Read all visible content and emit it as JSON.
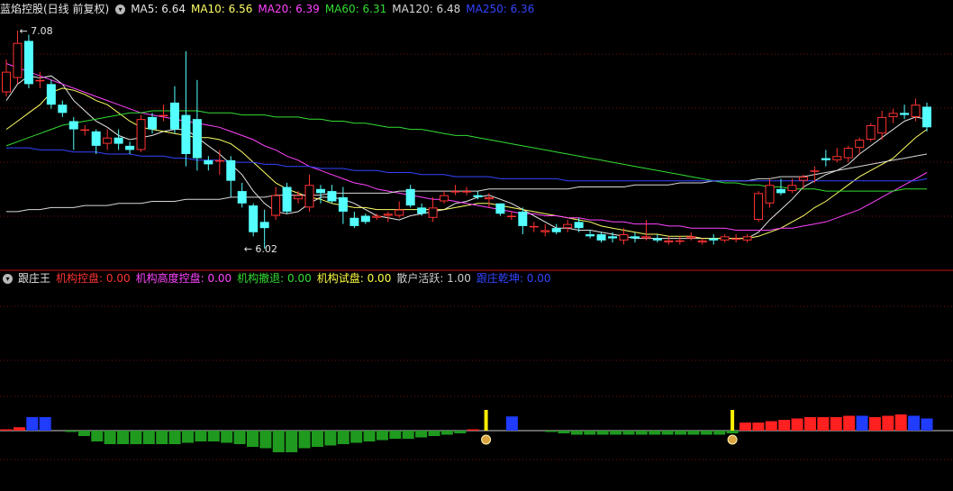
{
  "main_title": "蓝焰控股(日线 前复权)",
  "main_legend": [
    {
      "label": "MA5: 6.64",
      "color": "#e6e6e6"
    },
    {
      "label": "MA10: 6.56",
      "color": "#ffff66"
    },
    {
      "label": "MA20: 6.39",
      "color": "#ff44ff"
    },
    {
      "label": "MA60: 6.31",
      "color": "#33dd33"
    },
    {
      "label": "MA120: 6.48",
      "color": "#d8d8d8"
    },
    {
      "label": "MA250: 6.36",
      "color": "#3344ff"
    }
  ],
  "sub_title": "跟庄王",
  "sub_legend": [
    {
      "label": "机构控盘: 0.00",
      "color": "#ff3333"
    },
    {
      "label": "机构高度控盘: 0.00",
      "color": "#ff44ff"
    },
    {
      "label": "机构撤退: 0.00",
      "color": "#33dd33"
    },
    {
      "label": "机构试盘: 0.00",
      "color": "#ffff44"
    },
    {
      "label": "散户活跃: 1.00",
      "color": "#cccccc"
    },
    {
      "label": "跟庄乾坤: 0.00",
      "color": "#3344ff"
    }
  ],
  "chart_data": [
    {
      "type": "candlestick",
      "annotations": [
        {
          "text": "7.08",
          "bar": 1,
          "value": 7.08
        },
        {
          "text": "6.02",
          "bar": 21,
          "value": 6.02
        }
      ],
      "ylim": [
        5.95,
        7.15
      ],
      "candles": [
        [
          6.78,
          6.88,
          6.94,
          6.76
        ],
        [
          6.85,
          7.02,
          7.08,
          6.82
        ],
        [
          7.03,
          6.82,
          7.06,
          6.8
        ],
        [
          6.84,
          6.84,
          6.88,
          6.8
        ],
        [
          6.82,
          6.72,
          6.84,
          6.7
        ],
        [
          6.72,
          6.68,
          6.74,
          6.66
        ],
        [
          6.64,
          6.6,
          6.66,
          6.5
        ],
        [
          6.6,
          6.6,
          6.62,
          6.57
        ],
        [
          6.59,
          6.52,
          6.6,
          6.48
        ],
        [
          6.53,
          6.56,
          6.6,
          6.5
        ],
        [
          6.56,
          6.53,
          6.6,
          6.5
        ],
        [
          6.52,
          6.5,
          6.54,
          6.48
        ],
        [
          6.5,
          6.65,
          6.67,
          6.49
        ],
        [
          6.66,
          6.6,
          6.68,
          6.58
        ],
        [
          6.67,
          6.67,
          6.72,
          6.64
        ],
        [
          6.73,
          6.6,
          6.81,
          6.58
        ],
        [
          6.67,
          6.48,
          6.98,
          6.42
        ],
        [
          6.65,
          6.46,
          6.84,
          6.4
        ],
        [
          6.45,
          6.43,
          6.47,
          6.4
        ],
        [
          6.45,
          6.45,
          6.5,
          6.38
        ],
        [
          6.45,
          6.35,
          6.47,
          6.27
        ],
        [
          6.3,
          6.24,
          6.34,
          6.22
        ],
        [
          6.23,
          6.1,
          6.24,
          6.08
        ],
        [
          6.15,
          6.12,
          6.21,
          6.02
        ],
        [
          6.18,
          6.28,
          6.32,
          6.16
        ],
        [
          6.32,
          6.2,
          6.34,
          6.19
        ],
        [
          6.26,
          6.28,
          6.3,
          6.24
        ],
        [
          6.22,
          6.33,
          6.38,
          6.2
        ],
        [
          6.31,
          6.29,
          6.33,
          6.24
        ],
        [
          6.3,
          6.25,
          6.33,
          6.24
        ],
        [
          6.27,
          6.2,
          6.32,
          6.14
        ],
        [
          6.17,
          6.13,
          6.2,
          6.12
        ],
        [
          6.18,
          6.15,
          6.19,
          6.14
        ],
        [
          6.17,
          6.18,
          6.19,
          6.16
        ],
        [
          6.18,
          6.19,
          6.2,
          6.15
        ],
        [
          6.18,
          6.21,
          6.25,
          6.17
        ],
        [
          6.31,
          6.23,
          6.33,
          6.22
        ],
        [
          6.22,
          6.19,
          6.24,
          6.18
        ],
        [
          6.17,
          6.22,
          6.27,
          6.15
        ],
        [
          6.25,
          6.28,
          6.3,
          6.24
        ],
        [
          6.3,
          6.3,
          6.33,
          6.28
        ],
        [
          6.3,
          6.3,
          6.32,
          6.28
        ],
        [
          6.28,
          6.27,
          6.3,
          6.26
        ],
        [
          6.26,
          6.27,
          6.29,
          6.22
        ],
        [
          6.24,
          6.19,
          6.24,
          6.18
        ],
        [
          6.18,
          6.18,
          6.2,
          6.16
        ],
        [
          6.2,
          6.13,
          6.22,
          6.09
        ],
        [
          6.13,
          6.13,
          6.15,
          6.1
        ],
        [
          6.1,
          6.11,
          6.14,
          6.08
        ],
        [
          6.12,
          6.1,
          6.14,
          6.09
        ],
        [
          6.12,
          6.14,
          6.16,
          6.1
        ],
        [
          6.15,
          6.12,
          6.17,
          6.1
        ],
        [
          6.09,
          6.08,
          6.11,
          6.07
        ],
        [
          6.09,
          6.06,
          6.1,
          6.05
        ],
        [
          6.08,
          6.07,
          6.1,
          6.05
        ],
        [
          6.06,
          6.09,
          6.12,
          6.04
        ],
        [
          6.08,
          6.07,
          6.1,
          6.05
        ],
        [
          6.07,
          6.08,
          6.16,
          6.06
        ],
        [
          6.07,
          6.06,
          6.09,
          6.05
        ],
        [
          6.05,
          6.06,
          6.08,
          6.04
        ],
        [
          6.06,
          6.06,
          6.08,
          6.04
        ],
        [
          6.07,
          6.08,
          6.1,
          6.06
        ],
        [
          6.05,
          6.06,
          6.07,
          6.04
        ],
        [
          6.07,
          6.06,
          6.09,
          6.04
        ],
        [
          6.06,
          6.08,
          6.09,
          6.05
        ],
        [
          6.07,
          6.07,
          6.09,
          6.05
        ],
        [
          6.06,
          6.08,
          6.09,
          6.05
        ],
        [
          6.16,
          6.29,
          6.3,
          6.15
        ],
        [
          6.24,
          6.33,
          6.36,
          6.22
        ],
        [
          6.31,
          6.29,
          6.36,
          6.28
        ],
        [
          6.3,
          6.33,
          6.36,
          6.29
        ],
        [
          6.35,
          6.37,
          6.38,
          6.31
        ],
        [
          6.4,
          6.4,
          6.42,
          6.34
        ],
        [
          6.46,
          6.45,
          6.5,
          6.42
        ],
        [
          6.45,
          6.47,
          6.51,
          6.44
        ],
        [
          6.46,
          6.51,
          6.52,
          6.44
        ],
        [
          6.51,
          6.55,
          6.56,
          6.48
        ],
        [
          6.55,
          6.62,
          6.63,
          6.54
        ],
        [
          6.58,
          6.66,
          6.69,
          6.55
        ],
        [
          6.66,
          6.68,
          6.7,
          6.63
        ],
        [
          6.68,
          6.67,
          6.72,
          6.65
        ],
        [
          6.66,
          6.72,
          6.75,
          6.64
        ],
        [
          6.71,
          6.61,
          6.73,
          6.59
        ]
      ],
      "ma": [
        {
          "name": "MA5",
          "values": [
            6.74,
            6.82,
            6.86,
            6.85,
            6.86,
            6.82,
            6.74,
            6.69,
            6.64,
            6.61,
            6.57,
            6.55,
            6.56,
            6.57,
            6.59,
            6.6,
            6.6,
            6.56,
            6.52,
            6.48,
            6.43,
            6.38,
            6.3,
            6.24,
            6.2,
            6.19,
            6.2,
            6.24,
            6.27,
            6.27,
            6.26,
            6.24,
            6.21,
            6.18,
            6.17,
            6.16,
            6.18,
            6.19,
            6.2,
            6.21,
            6.24,
            6.25,
            6.27,
            6.28,
            6.26,
            6.24,
            6.21,
            6.18,
            6.15,
            6.12,
            6.12,
            6.11,
            6.11,
            6.1,
            6.09,
            6.08,
            6.07,
            6.07,
            6.07,
            6.07,
            6.07,
            6.07,
            6.07,
            6.07,
            6.07,
            6.07,
            6.07,
            6.1,
            6.16,
            6.21,
            6.26,
            6.32,
            6.35,
            6.38,
            6.4,
            6.43,
            6.48,
            6.52,
            6.56,
            6.6,
            6.64,
            6.66,
            6.65
          ]
        },
        {
          "name": "MA10",
          "values": [
            6.6,
            6.64,
            6.68,
            6.72,
            6.78,
            6.8,
            6.79,
            6.77,
            6.74,
            6.72,
            6.68,
            6.64,
            6.61,
            6.6,
            6.59,
            6.58,
            6.57,
            6.56,
            6.56,
            6.55,
            6.53,
            6.49,
            6.44,
            6.39,
            6.34,
            6.31,
            6.29,
            6.27,
            6.26,
            6.24,
            6.23,
            6.22,
            6.22,
            6.21,
            6.21,
            6.21,
            6.21,
            6.21,
            6.21,
            6.21,
            6.22,
            6.23,
            6.24,
            6.24,
            6.23,
            6.22,
            6.21,
            6.2,
            6.19,
            6.18,
            6.17,
            6.16,
            6.15,
            6.13,
            6.12,
            6.11,
            6.1,
            6.09,
            6.09,
            6.08,
            6.08,
            6.08,
            6.07,
            6.07,
            6.07,
            6.07,
            6.07,
            6.08,
            6.1,
            6.12,
            6.15,
            6.18,
            6.22,
            6.25,
            6.29,
            6.33,
            6.37,
            6.4,
            6.43,
            6.46,
            6.51,
            6.56,
            6.6
          ]
        },
        {
          "name": "MA20",
          "values": [
            6.92,
            6.9,
            6.88,
            6.86,
            6.84,
            6.82,
            6.8,
            6.78,
            6.76,
            6.74,
            6.72,
            6.7,
            6.68,
            6.67,
            6.66,
            6.65,
            6.64,
            6.63,
            6.62,
            6.61,
            6.59,
            6.57,
            6.55,
            6.52,
            6.5,
            6.47,
            6.45,
            6.42,
            6.4,
            6.38,
            6.36,
            6.34,
            6.33,
            6.31,
            6.3,
            6.29,
            6.28,
            6.27,
            6.26,
            6.26,
            6.25,
            6.24,
            6.23,
            6.22,
            6.21,
            6.2,
            6.19,
            6.19,
            6.18,
            6.18,
            6.17,
            6.17,
            6.16,
            6.16,
            6.15,
            6.15,
            6.14,
            6.14,
            6.14,
            6.13,
            6.13,
            6.12,
            6.12,
            6.12,
            6.12,
            6.11,
            6.11,
            6.11,
            6.11,
            6.12,
            6.12,
            6.13,
            6.14,
            6.15,
            6.17,
            6.19,
            6.21,
            6.24,
            6.27,
            6.3,
            6.33,
            6.36,
            6.39
          ]
        },
        {
          "name": "MA60",
          "values": [
            6.52,
            6.54,
            6.56,
            6.58,
            6.6,
            6.62,
            6.63,
            6.64,
            6.65,
            6.66,
            6.67,
            6.68,
            6.68,
            6.69,
            6.69,
            6.69,
            6.69,
            6.69,
            6.68,
            6.68,
            6.68,
            6.67,
            6.67,
            6.67,
            6.66,
            6.66,
            6.66,
            6.65,
            6.65,
            6.64,
            6.64,
            6.63,
            6.63,
            6.62,
            6.61,
            6.61,
            6.6,
            6.6,
            6.59,
            6.58,
            6.57,
            6.57,
            6.56,
            6.55,
            6.54,
            6.53,
            6.52,
            6.51,
            6.5,
            6.49,
            6.48,
            6.47,
            6.46,
            6.45,
            6.44,
            6.43,
            6.42,
            6.41,
            6.4,
            6.39,
            6.38,
            6.37,
            6.36,
            6.35,
            6.34,
            6.34,
            6.33,
            6.33,
            6.32,
            6.32,
            6.31,
            6.31,
            6.31,
            6.3,
            6.3,
            6.3,
            6.3,
            6.3,
            6.3,
            6.3,
            6.31,
            6.31,
            6.31
          ]
        },
        {
          "name": "MA120",
          "values": [
            6.2,
            6.2,
            6.21,
            6.21,
            6.22,
            6.22,
            6.22,
            6.23,
            6.23,
            6.23,
            6.24,
            6.24,
            6.24,
            6.25,
            6.25,
            6.25,
            6.26,
            6.26,
            6.26,
            6.26,
            6.27,
            6.27,
            6.27,
            6.27,
            6.28,
            6.28,
            6.28,
            6.28,
            6.28,
            6.29,
            6.29,
            6.29,
            6.29,
            6.29,
            6.29,
            6.3,
            6.3,
            6.3,
            6.3,
            6.3,
            6.3,
            6.3,
            6.3,
            6.31,
            6.31,
            6.31,
            6.31,
            6.31,
            6.31,
            6.31,
            6.31,
            6.32,
            6.32,
            6.32,
            6.32,
            6.32,
            6.33,
            6.33,
            6.33,
            6.33,
            6.34,
            6.34,
            6.34,
            6.35,
            6.35,
            6.35,
            6.35,
            6.36,
            6.36,
            6.37,
            6.37,
            6.37,
            6.38,
            6.39,
            6.4,
            6.41,
            6.42,
            6.43,
            6.44,
            6.45,
            6.46,
            6.47,
            6.48
          ]
        },
        {
          "name": "MA250",
          "values": [
            6.51,
            6.51,
            6.51,
            6.5,
            6.5,
            6.5,
            6.49,
            6.49,
            6.49,
            6.48,
            6.48,
            6.48,
            6.47,
            6.47,
            6.47,
            6.46,
            6.46,
            6.45,
            6.45,
            6.45,
            6.44,
            6.44,
            6.44,
            6.43,
            6.43,
            6.42,
            6.42,
            6.42,
            6.41,
            6.41,
            6.41,
            6.4,
            6.4,
            6.4,
            6.39,
            6.39,
            6.39,
            6.38,
            6.38,
            6.38,
            6.37,
            6.37,
            6.37,
            6.37,
            6.36,
            6.36,
            6.36,
            6.36,
            6.36,
            6.36,
            6.35,
            6.35,
            6.35,
            6.35,
            6.35,
            6.35,
            6.35,
            6.35,
            6.35,
            6.35,
            6.35,
            6.35,
            6.35,
            6.35,
            6.35,
            6.35,
            6.35,
            6.35,
            6.35,
            6.35,
            6.35,
            6.35,
            6.35,
            6.35,
            6.35,
            6.35,
            6.35,
            6.35,
            6.35,
            6.35,
            6.35,
            6.35,
            6.36
          ]
        }
      ]
    },
    {
      "type": "bar",
      "ylim": [
        -1.6,
        1.6
      ],
      "values": [
        0.1,
        0.25,
        1.0,
        1.0,
        0,
        -0.1,
        -0.4,
        -0.8,
        -1.0,
        -1.0,
        -1.0,
        -1.0,
        -1.0,
        -1.0,
        -0.9,
        -0.8,
        -0.8,
        -0.9,
        -1.0,
        -1.2,
        -1.3,
        -1.6,
        -1.6,
        -1.3,
        -1.2,
        -1.1,
        -1.0,
        -0.9,
        -0.8,
        -0.7,
        -0.6,
        -0.6,
        -0.5,
        -0.4,
        -0.3,
        -0.2,
        0.1,
        0,
        0,
        1.05,
        0,
        0,
        -0.1,
        -0.2,
        -0.3,
        -0.3,
        -0.3,
        -0.3,
        -0.3,
        -0.3,
        -0.3,
        -0.3,
        -0.3,
        -0.3,
        -0.3,
        -0.3,
        -0.2,
        0.6,
        0.6,
        0.7,
        0.8,
        0.9,
        1.0,
        1.0,
        1.0,
        1.1,
        1.1,
        1.0,
        1.1,
        1.2,
        1.1,
        0.9
      ],
      "colors": [
        "r",
        "r",
        "b",
        "b",
        "r",
        "g",
        "g",
        "g",
        "g",
        "g",
        "g",
        "g",
        "g",
        "g",
        "g",
        "g",
        "g",
        "g",
        "g",
        "g",
        "g",
        "g",
        "g",
        "g",
        "g",
        "g",
        "g",
        "g",
        "g",
        "g",
        "g",
        "g",
        "g",
        "g",
        "g",
        "g",
        "r",
        "r",
        "r",
        "b",
        "r",
        "r",
        "g",
        "g",
        "g",
        "g",
        "g",
        "g",
        "g",
        "g",
        "g",
        "g",
        "g",
        "g",
        "g",
        "g",
        "g",
        "r",
        "r",
        "r",
        "r",
        "r",
        "r",
        "r",
        "r",
        "r",
        "b",
        "r",
        "r",
        "r",
        "b",
        "b"
      ],
      "signal_bars": [
        37,
        56
      ]
    }
  ]
}
